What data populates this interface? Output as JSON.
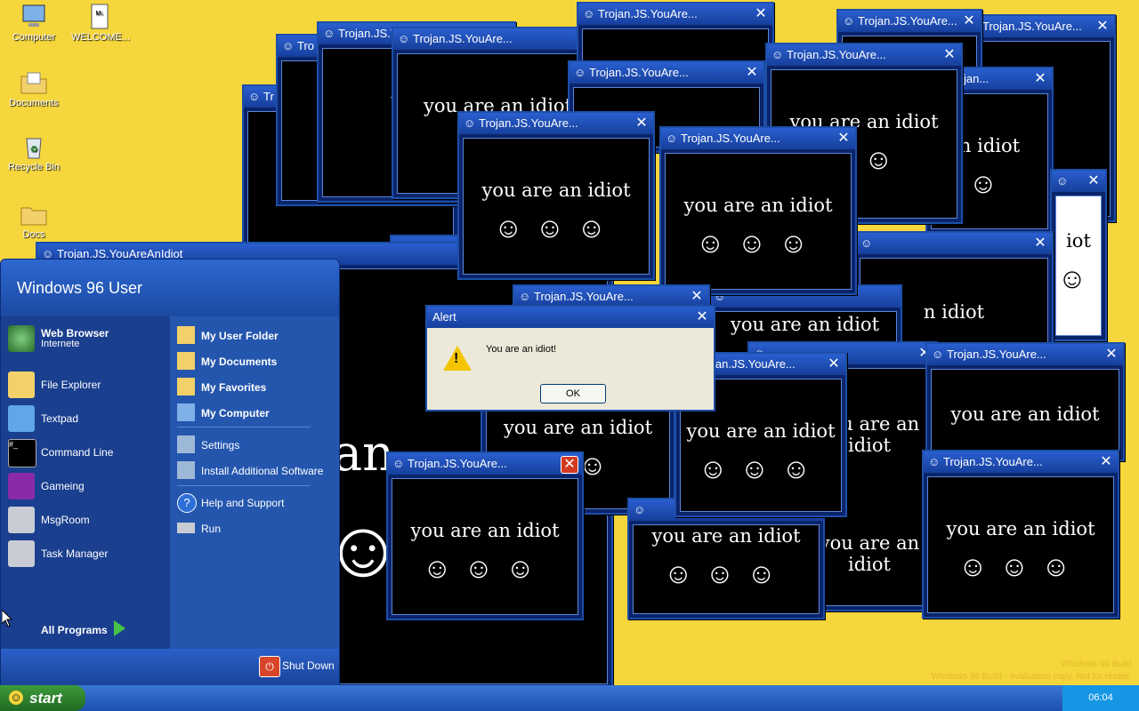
{
  "desktop_icons": [
    "Computer",
    "WELCOME...",
    "Documents",
    "Recycle Bin",
    "Docs"
  ],
  "popup_title": "Trojan.JS.YouAre...",
  "popup_title_long": "Trojan.JS.YouAreAnIdiot",
  "popup_message": "you are an idiot",
  "popup_faces": "☺☺☺",
  "partial_titles": {
    "t1": "Tro",
    "t2": "Trojan.JS",
    "t3": "Trojan..",
    "t4": "Troj",
    "t5": "Troja",
    "t6": "Tr",
    "t7": "Tr",
    "t8": "Trojan..."
  },
  "partial_msgs": {
    "m1": "you a",
    "m2": "n idiot",
    "m3": "iot",
    "m4": "ran"
  },
  "alert": {
    "title": "Alert",
    "message": "You are an idiot!",
    "ok": "OK"
  },
  "start_menu": {
    "user": "Windows 96 User",
    "left_items": [
      {
        "label": "Web Browser",
        "sub": "Internete"
      },
      {
        "label": "File Explorer"
      },
      {
        "label": "Textpad"
      },
      {
        "label": "Command Line"
      },
      {
        "label": "Gameing"
      },
      {
        "label": "MsgRoom"
      },
      {
        "label": "Task Manager"
      }
    ],
    "all_programs": "All Programs",
    "right_items": [
      "My User Folder",
      "My Documents",
      "My Favorites",
      "My Computer",
      "Settings",
      "Install Additional Software",
      "Help and Support",
      "Run"
    ],
    "shutdown": "Shut Down"
  },
  "taskbar": {
    "start_label": "start",
    "clock": "06:04"
  },
  "watermark": {
    "line1": "Windows 96 Build",
    "line2": "Windows 96 Build - evaluation copy. Not for resale."
  },
  "colors": {
    "desktop": "#f5d63c",
    "titlebar": "#2a5fcf",
    "popup_body": "#000000",
    "start_button": "#3d9a3a"
  }
}
